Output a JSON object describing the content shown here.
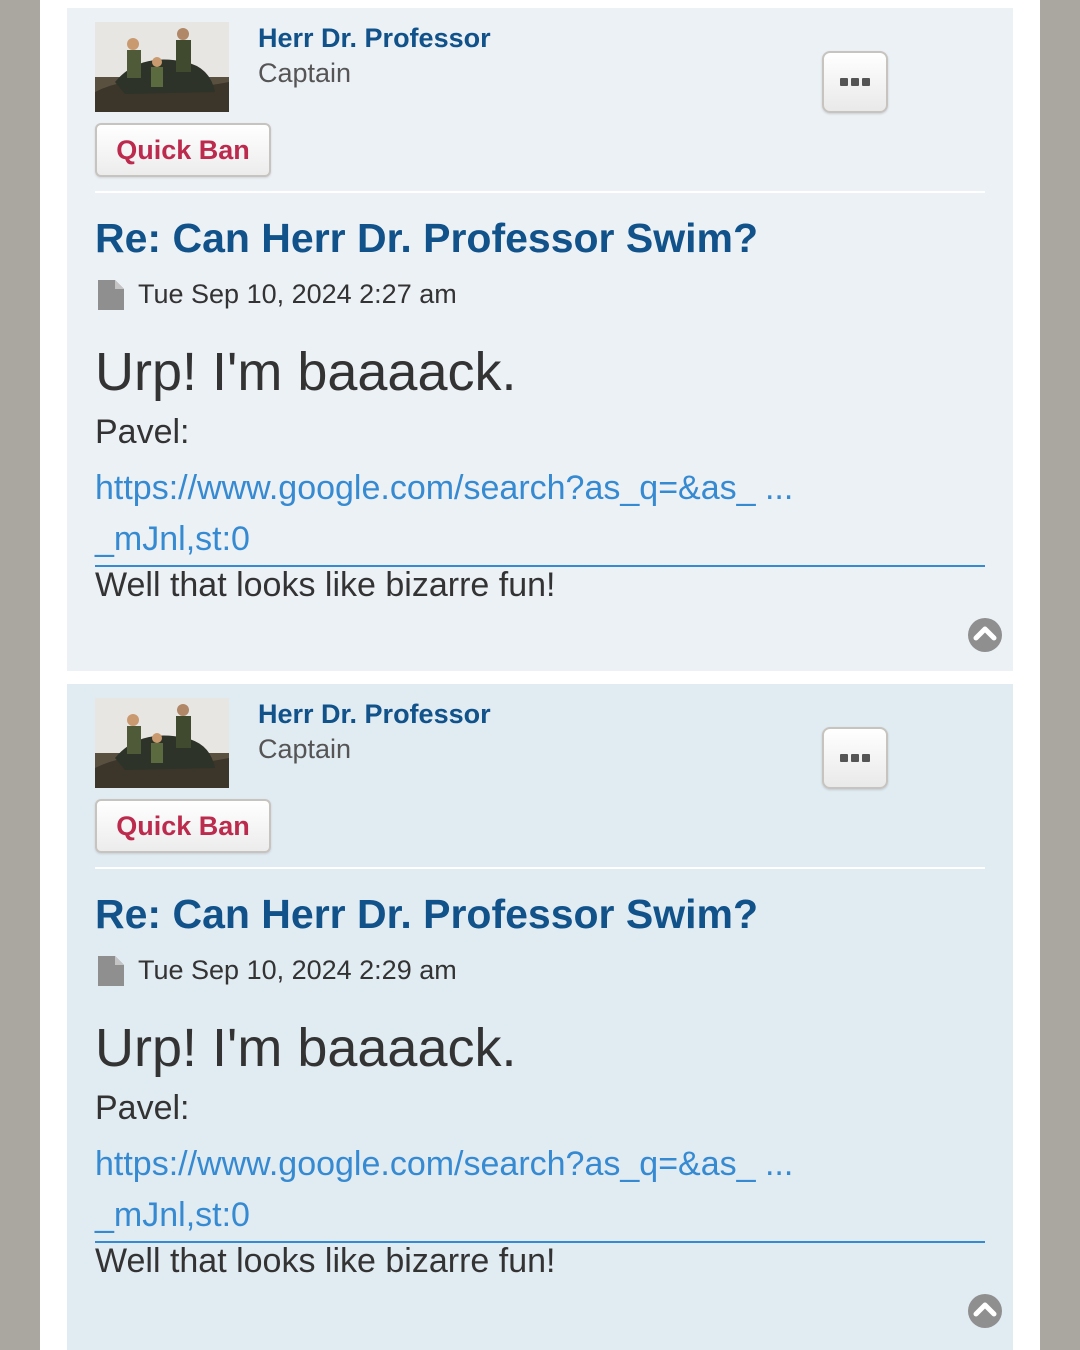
{
  "posts": [
    {
      "author": "Herr Dr. Professor",
      "rank": "Captain",
      "quick_ban_label": "Quick Ban",
      "title": "Re: Can Herr Dr. Professor Swim?",
      "date": "Tue Sep 10, 2024 2:27 am",
      "headline": "Urp! I'm baaaack.",
      "quote_label": "Pavel:",
      "link_line1": "https://www.google.com/search?as_q=&as_ ...",
      "link_line2": "_mJnl,st:0",
      "comment": "Well that looks like bizarre fun!"
    },
    {
      "author": "Herr Dr. Professor",
      "rank": "Captain",
      "quick_ban_label": "Quick Ban",
      "title": "Re: Can Herr Dr. Professor Swim?",
      "date": "Tue Sep 10, 2024 2:29 am",
      "headline": "Urp! I'm baaaack.",
      "quote_label": "Pavel:",
      "link_line1": "https://www.google.com/search?as_q=&as_ ...",
      "link_line2": "_mJnl,st:0",
      "comment": "Well that looks like bizarre fun!"
    }
  ],
  "icons": {
    "post_menu": "ellipsis-icon",
    "post_date": "file-icon",
    "back_to_top": "chevron-up-circle-icon"
  },
  "colors": {
    "link": "#368ad2",
    "username": "#105289",
    "quick_ban": "#bc2a4d",
    "post_bg_odd": "#ecf1f6",
    "post_bg_even": "#e1ebf2"
  }
}
